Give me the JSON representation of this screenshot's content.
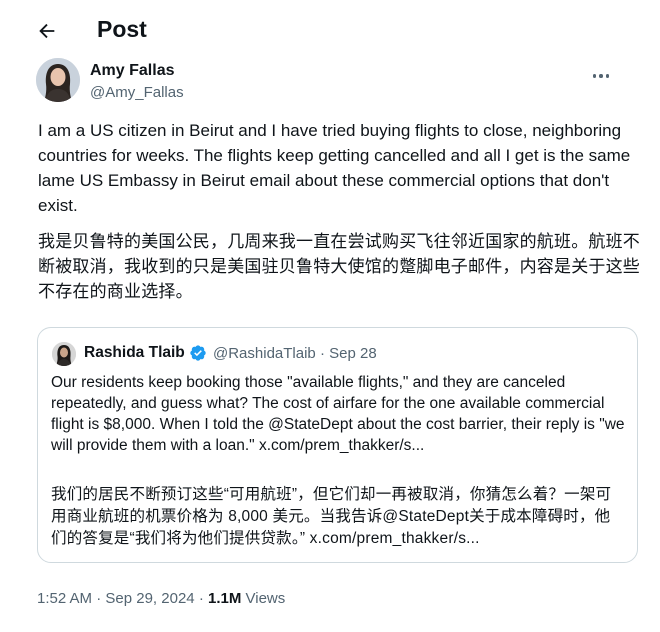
{
  "header": {
    "title": "Post"
  },
  "author": {
    "name": "Amy Fallas",
    "handle": "@Amy_Fallas"
  },
  "post": {
    "text_en": "I am a US citizen in Beirut and I have tried buying flights to close, neighboring countries for weeks. The flights keep getting cancelled and all I get is the same lame US Embassy in Beirut email about these commercial options that don't exist.",
    "text_zh": "我是贝鲁特的美国公民，几周来我一直在尝试购买飞往邻近国家的航班。航班不断被取消，我收到的只是美国驻贝鲁特大使馆的蹩脚电子邮件，内容是关于这些不存在的商业选择。"
  },
  "quote": {
    "name": "Rashida Tlaib",
    "handle": "@RashidaTlaib",
    "separator": "·",
    "date": "Sep 28",
    "text_en": "Our residents keep booking those \"available flights,\" and they are canceled repeatedly, and guess what? The cost of airfare for the one available commercial flight is $8,000. When I told the @StateDept about the cost barrier,  their reply is \"we will provide them with a loan.\" x.com/prem_thakker/s...",
    "text_zh": "我们的居民不断预订这些“可用航班”，但它们却一再被取消，你猜怎么着？一架可用商业航班的机票价格为 8,000 美元。当我告诉@StateDept关于成本障碍时，他们的答复是“我们将为他们提供贷款。” x.com/prem_thakker/s..."
  },
  "meta": {
    "time": "1:52 AM",
    "date": "Sep 29, 2024",
    "separator": "·",
    "views_count": "1.1M",
    "views_label": "Views"
  },
  "icons": {
    "back": "arrow-left-icon",
    "more": "more-horizontal-icon",
    "verified": "verified-badge-icon"
  },
  "colors": {
    "text": "#0f1419",
    "secondary": "#536471",
    "border": "#cfd9de",
    "verified": "#1d9bf0"
  }
}
